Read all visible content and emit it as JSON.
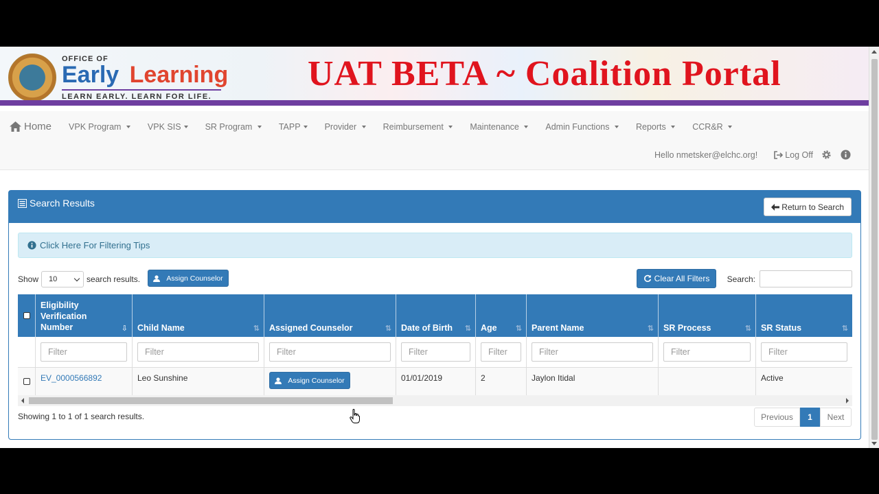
{
  "banner": {
    "office_of": "OFFICE OF",
    "logo_word1": "Early",
    "logo_word2": "Learning",
    "tagline": "LEARN EARLY. LEARN FOR LIFE.",
    "portal_title": "UAT BETA ~ Coalition Portal",
    "title_color": "#e0141e",
    "stripe_color": "#6e3ea0"
  },
  "nav": {
    "home": "Home",
    "items": [
      "VPK Program",
      "VPK SIS",
      "SR Program",
      "TAPP",
      "Provider",
      "Reimbursement",
      "Maintenance",
      "Admin Functions",
      "Reports",
      "CCR&R"
    ],
    "greeting": "Hello nmetsker@elchc.org!",
    "logoff": "Log Off"
  },
  "panel": {
    "title": "Search Results",
    "return_button": "Return to Search",
    "tips": "Click Here For Filtering Tips",
    "show_label": "Show",
    "page_size": "10",
    "search_results_label": "search results.",
    "assign_button": "Assign Counselor",
    "clear_filters": "Clear All Filters",
    "search_label": "Search:",
    "accent_color": "#337ab7"
  },
  "table": {
    "headers": [
      "Eligibility Verification Number",
      "Child Name",
      "Assigned Counselor",
      "Date of Birth",
      "Age",
      "Parent Name",
      "SR Process",
      "SR Status"
    ],
    "filter_placeholder": "Filter",
    "rows": [
      {
        "ev_number": "EV_0000566892",
        "child_name": "Leo Sunshine",
        "assign_label": "Assign Counselor",
        "dob": "01/01/2019",
        "age": "2",
        "parent_name": "Jaylon Itidal",
        "sr_process": "",
        "sr_status": "Active"
      }
    ]
  },
  "footer": {
    "showing": "Showing 1 to 1 of 1 search results.",
    "previous": "Previous",
    "current_page": "1",
    "next": "Next"
  }
}
